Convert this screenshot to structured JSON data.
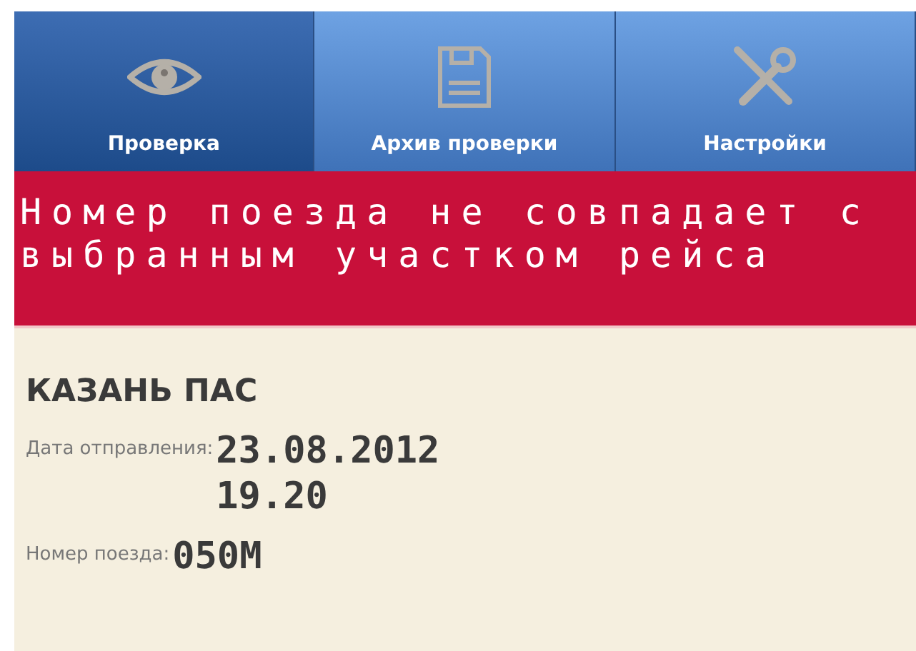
{
  "tabs": [
    {
      "label": "Проверка",
      "kind": "eye",
      "selected": true
    },
    {
      "label": "Архив проверки",
      "kind": "floppy",
      "selected": false
    },
    {
      "label": "Настройки",
      "kind": "tools",
      "selected": false
    }
  ],
  "error_banner": {
    "text": "Номер поезда не совпадает с выбранным участком рейса"
  },
  "details": {
    "station": "КАЗАНЬ ПАС",
    "fields": [
      {
        "label": "Дата отправления:",
        "values": [
          "23.08.2012",
          "19.20"
        ]
      },
      {
        "label": "Номер поезда:",
        "values": [
          "050М"
        ]
      }
    ]
  }
}
